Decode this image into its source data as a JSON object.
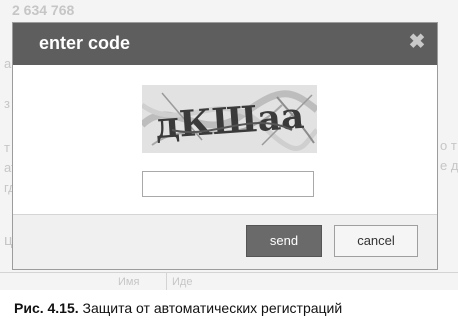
{
  "background": {
    "fragments": [
      "2 634 768",
      "а",
      "з",
      "т",
      "ат",
      "гд",
      "ц",
      "о т",
      "е д",
      "Имя",
      "Иде"
    ]
  },
  "dialog": {
    "title": "enter code",
    "close_icon": "close-icon",
    "captcha_text": "дКШаа",
    "input_value": "",
    "send_label": "send",
    "cancel_label": "cancel"
  },
  "caption": {
    "number": "Рис. 4.15.",
    "text": " Защита от автоматических регистраций"
  },
  "colors": {
    "titlebar": "#5e5e5e",
    "send_button": "#6a6a6a",
    "page_background": "#f4f4f4"
  }
}
